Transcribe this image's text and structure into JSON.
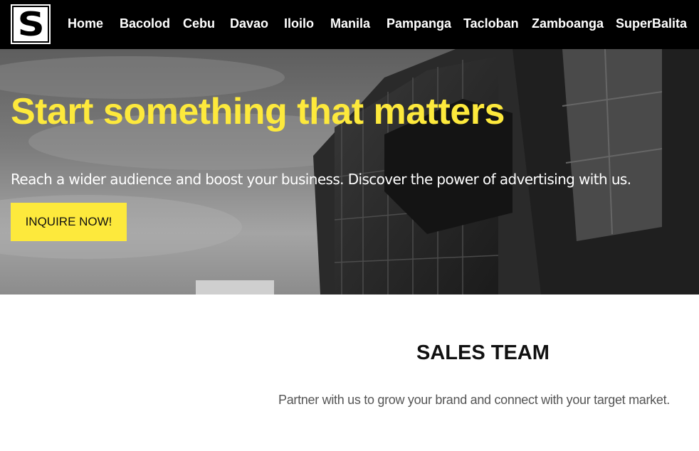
{
  "nav": {
    "logo_letter": "S",
    "links": [
      {
        "label": "Home"
      },
      {
        "label": "Bacolod"
      },
      {
        "label": "Cebu"
      },
      {
        "label": "Davao"
      },
      {
        "label": "Iloilo"
      },
      {
        "label": "Manila"
      },
      {
        "label": "Pampanga"
      },
      {
        "label": "Tacloban"
      },
      {
        "label": "Zamboanga"
      },
      {
        "label": "SuperBalita"
      }
    ]
  },
  "hero": {
    "title": "Start something that matters",
    "subtitle": "Reach a wider audience and boost your business. Discover the power of advertising with us.",
    "cta_label": "INQUIRE NOW!"
  },
  "sales": {
    "title": "SALES TEAM",
    "description": "Partner with us to grow your brand and connect with your target market."
  },
  "colors": {
    "accent_yellow": "#fde93c",
    "nav_bg": "#000000",
    "text_dark": "#111111",
    "text_muted": "#555555"
  }
}
